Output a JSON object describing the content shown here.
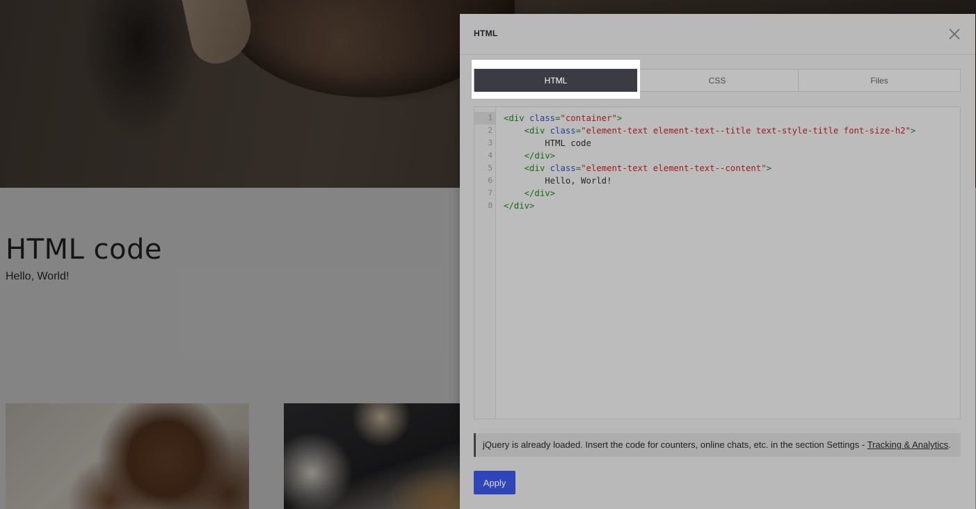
{
  "page": {
    "heading": "HTML code",
    "text": "Hello, World!"
  },
  "modal": {
    "title": "HTML",
    "tabs": [
      {
        "label": "HTML",
        "active": true
      },
      {
        "label": "CSS",
        "active": false
      },
      {
        "label": "Files",
        "active": false
      }
    ],
    "editor": {
      "line_numbers": [
        "1",
        "2",
        "3",
        "4",
        "5",
        "6",
        "7",
        "8"
      ],
      "lines": [
        {
          "indent": "",
          "open": "<div ",
          "attr": "class",
          "eq": "=",
          "value": "\"container\"",
          "close": ">",
          "text": ""
        },
        {
          "indent": "    ",
          "open": "<div ",
          "attr": "class",
          "eq": "=",
          "value": "\"element-text element-text--title text-style-title font-size-h2\"",
          "close": ">",
          "text": ""
        },
        {
          "indent": "        ",
          "open": "",
          "attr": "",
          "eq": "",
          "value": "",
          "close": "",
          "text": "HTML code"
        },
        {
          "indent": "    ",
          "open": "</div>",
          "attr": "",
          "eq": "",
          "value": "",
          "close": "",
          "text": ""
        },
        {
          "indent": "    ",
          "open": "<div ",
          "attr": "class",
          "eq": "=",
          "value": "\"element-text element-text--content\"",
          "close": ">",
          "text": ""
        },
        {
          "indent": "        ",
          "open": "",
          "attr": "",
          "eq": "",
          "value": "",
          "close": "",
          "text": "Hello, World!"
        },
        {
          "indent": "    ",
          "open": "</div>",
          "attr": "",
          "eq": "",
          "value": "",
          "close": "",
          "text": ""
        },
        {
          "indent": "",
          "open": "</div>",
          "attr": "",
          "eq": "",
          "value": "",
          "close": "",
          "text": ""
        }
      ]
    },
    "notice": {
      "text": "jQuery is already loaded. Insert the code for counters, online chats, etc. in the section Settings - ",
      "link": "Tracking & Analytics",
      "suffix": "."
    },
    "apply_label": "Apply"
  }
}
